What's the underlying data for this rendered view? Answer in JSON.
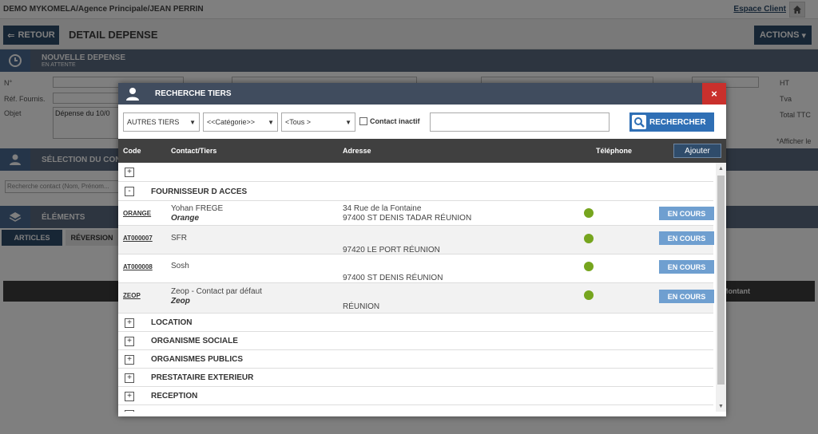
{
  "app": {
    "breadcrumb": "DEMO MYKOMELA/Agence Principale/JEAN PERRIN",
    "espace_client": "Espace Client",
    "back_label": "RETOUR",
    "page_title": "DETAIL DEPENSE",
    "actions_label": "ACTIONS",
    "section_new": "NOUVELLE DEPENSE",
    "section_new_sub": "EN ATTENTE",
    "section_contact": "SÉLECTION DU CONTACT",
    "section_elements": "ÉLÉMENTS",
    "tab_articles": "ARTICLES",
    "tab_reverse": "RÉVERSION",
    "field_num": "N°",
    "field_ref": "Réf. Fournis.",
    "field_objet": "Objet",
    "objet_value": "Dépense du 10/0",
    "total_ht": "HT",
    "total_tva": "Tva",
    "total_ttc": "Total TTC",
    "afficher": "*Afficher le",
    "montant": "Montant",
    "search_contact_placeholder": "Recherche contact (Nom, Prénom..."
  },
  "modal": {
    "title": "RECHERCHE TIERS",
    "close": "×",
    "filters": {
      "type": "AUTRES TIERS",
      "categorie": "<<Catégorie>>",
      "tous": "<Tous >",
      "inactive_label": "Contact inactif",
      "search_value": "",
      "search_button": "RECHERCHER"
    },
    "columns": {
      "code": "Code",
      "contact": "Contact/Tiers",
      "adresse": "Adresse",
      "telephone": "Téléphone",
      "ajouter": "Ajouter"
    },
    "group_open": "FOURNISSEUR D ACCES",
    "rows": [
      {
        "code": "ORANGE",
        "contact": "Yohan FREGE",
        "tiers": "Orange",
        "addr1": "34 Rue de la Fontaine",
        "addr2": "97400 ST DENIS TADAR RÉUNION",
        "status": "EN COURS"
      },
      {
        "code": "AT000007",
        "contact": "SFR",
        "tiers": "",
        "addr1": "",
        "addr2": "97420 LE PORT RÉUNION",
        "status": "EN COURS"
      },
      {
        "code": "AT000008",
        "contact": "Sosh",
        "tiers": "",
        "addr1": "",
        "addr2": "97400 ST DENIS RÉUNION",
        "status": "EN COURS"
      },
      {
        "code": "ZEOP",
        "contact": "Zeop - Contact par défaut",
        "tiers": "Zeop",
        "addr1": "",
        "addr2": "RÉUNION",
        "status": "EN COURS"
      }
    ],
    "groups_closed": [
      "LOCATION",
      "ORGANISME SOCIALE",
      "ORGANISMES PUBLICS",
      "PRESTATAIRE EXTERIEUR",
      "RECEPTION"
    ],
    "expand_sign": "+",
    "collapse_sign": "-"
  },
  "colors": {
    "header_dark": "#404c5e",
    "close_red": "#c9302c",
    "primary_blue": "#2f6fb5",
    "status_blue": "#6f9fd0",
    "active_green": "#76a51e"
  }
}
